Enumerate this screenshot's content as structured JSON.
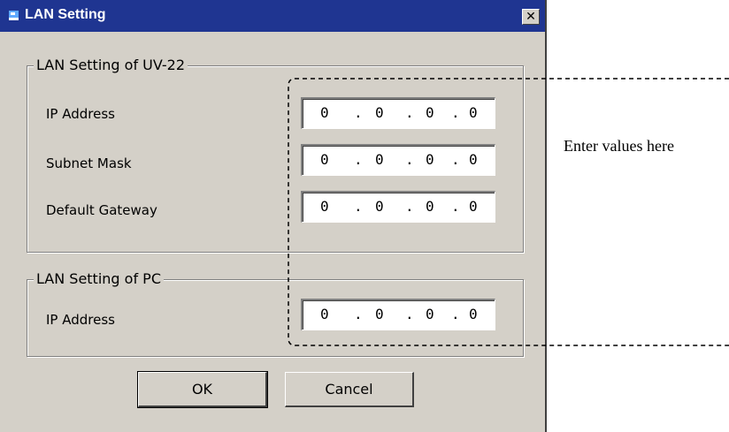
{
  "window": {
    "title": "LAN Setting",
    "close_glyph": "✕",
    "icon": "app-network-icon"
  },
  "uv_group": {
    "legend": "LAN Setting of UV-22",
    "fields": [
      {
        "label": "IP Address",
        "octets": [
          "0",
          "0",
          "0",
          "0"
        ]
      },
      {
        "label": "Subnet Mask",
        "octets": [
          "0",
          "0",
          "0",
          "0"
        ]
      },
      {
        "label": "Default Gateway",
        "octets": [
          "0",
          "0",
          "0",
          "0"
        ]
      }
    ]
  },
  "pc_group": {
    "legend": "LAN Setting of PC",
    "fields": [
      {
        "label": "IP Address",
        "octets": [
          "0",
          "0",
          "0",
          "0"
        ]
      }
    ]
  },
  "ip_separator": ".",
  "buttons": {
    "ok_label": "OK",
    "cancel_label": "Cancel"
  },
  "annotation": {
    "text": "Enter values here"
  },
  "colors": {
    "title_bar": "#1f3591",
    "dialog_face": "#d4d0c8",
    "field_bg": "#ffffff"
  }
}
